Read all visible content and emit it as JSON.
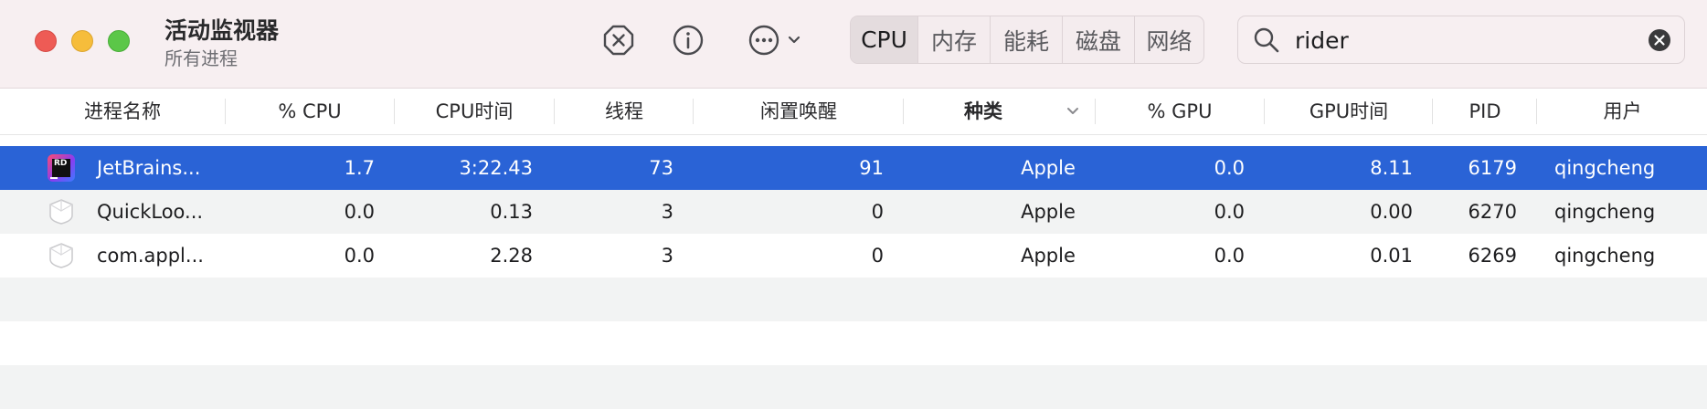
{
  "app": {
    "title": "活动监视器",
    "subtitle": "所有进程"
  },
  "toolbar_buttons": [
    "stop-process-icon",
    "info-icon",
    "more-icon"
  ],
  "tabs": [
    {
      "label": "CPU",
      "active": true
    },
    {
      "label": "内存",
      "active": false
    },
    {
      "label": "能耗",
      "active": false
    },
    {
      "label": "磁盘",
      "active": false
    },
    {
      "label": "网络",
      "active": false
    }
  ],
  "search": {
    "value": "rider"
  },
  "columns": [
    "进程名称",
    "% CPU",
    "CPU时间",
    "线程",
    "闲置唤醒",
    "种类",
    "% GPU",
    "GPU时间",
    "PID",
    "用户"
  ],
  "sort_column": "种类",
  "rows": [
    {
      "name": "JetBrains...",
      "cpu": "1.7",
      "cpu_time": "3:22.43",
      "threads": "73",
      "idle_wake": "91",
      "kind": "Apple",
      "gpu": "0.0",
      "gpu_time": "8.11",
      "pid": "6179",
      "user": "qingcheng",
      "icon": "rider-app-icon",
      "selected": true
    },
    {
      "name": "QuickLoo...",
      "cpu": "0.0",
      "cpu_time": "0.13",
      "threads": "3",
      "idle_wake": "0",
      "kind": "Apple",
      "gpu": "0.0",
      "gpu_time": "0.00",
      "pid": "6270",
      "user": "qingcheng",
      "icon": "generic-process-icon",
      "selected": false
    },
    {
      "name": "com.appl...",
      "cpu": "0.0",
      "cpu_time": "2.28",
      "threads": "3",
      "idle_wake": "0",
      "kind": "Apple",
      "gpu": "0.0",
      "gpu_time": "0.01",
      "pid": "6269",
      "user": "qingcheng",
      "icon": "generic-process-icon",
      "selected": false
    }
  ],
  "colors": {
    "selection": "#2a63d6",
    "alt_row": "#f2f3f3",
    "toolbar_bg": "#f7eff1"
  }
}
